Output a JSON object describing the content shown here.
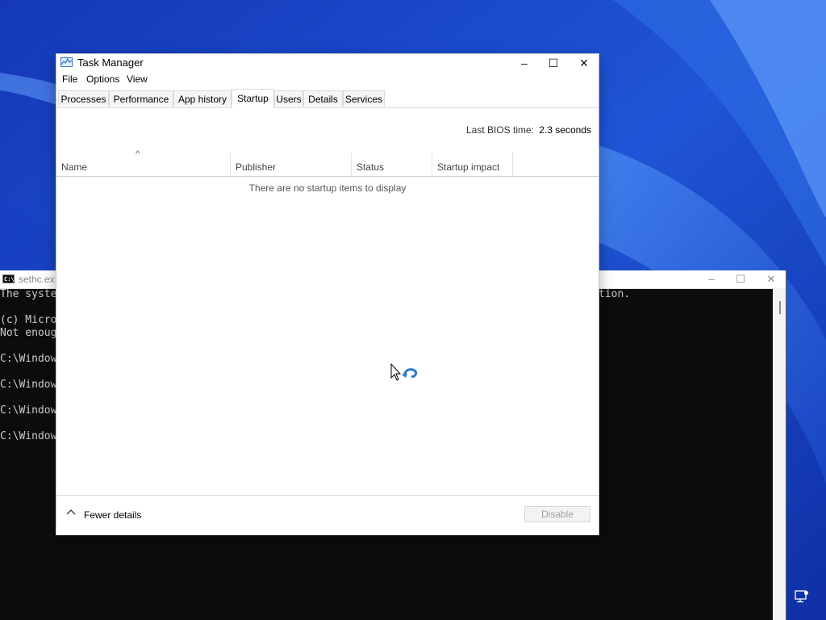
{
  "desktop": {
    "accent_color": "#1a49c9"
  },
  "console_window": {
    "title": "sethc.ex",
    "lines": [
      "The syste",
      "(c) Micro",
      "Not enoug",
      "C:\\Window",
      "C:\\Window",
      "C:\\Window",
      "C:\\Window"
    ],
    "line_tail": "tion.",
    "minimize_icon": "minimize-icon",
    "maximize_icon": "maximize-icon",
    "close_icon": "close-icon"
  },
  "task_manager": {
    "title": "Task Manager",
    "window_controls": {
      "minimize": "–",
      "maximize": "☐",
      "close": "✕"
    },
    "menu": [
      "File",
      "Options",
      "View"
    ],
    "tabs": [
      "Processes",
      "Performance",
      "App history",
      "Startup",
      "Users",
      "Details",
      "Services"
    ],
    "active_tab": "Startup",
    "bios": {
      "label": "Last BIOS time:",
      "value": "2.3 seconds"
    },
    "columns": [
      "Name",
      "Publisher",
      "Status",
      "Startup impact"
    ],
    "sort_indicator": "^",
    "empty_message": "There are no startup items to display",
    "footer": {
      "fewer_details": "Fewer details",
      "disable_button": "Disable"
    }
  }
}
